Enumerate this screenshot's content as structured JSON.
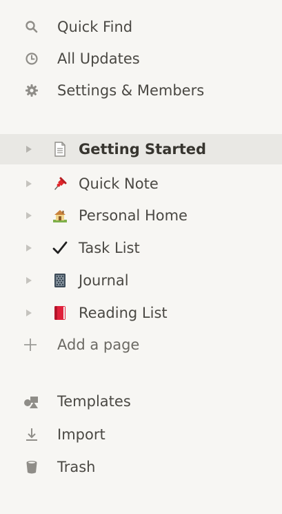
{
  "top_items": [
    {
      "label": "Quick Find",
      "icon": "search-icon"
    },
    {
      "label": "All Updates",
      "icon": "clock-icon"
    },
    {
      "label": "Settings & Members",
      "icon": "gear-icon"
    }
  ],
  "pages": [
    {
      "label": "Getting Started",
      "icon": "document-icon",
      "active": true
    },
    {
      "label": "Quick Note",
      "icon": "pushpin-icon",
      "active": false
    },
    {
      "label": "Personal Home",
      "icon": "house-icon",
      "active": false
    },
    {
      "label": "Task List",
      "icon": "checkmark-icon",
      "active": false
    },
    {
      "label": "Journal",
      "icon": "notebook-icon",
      "active": false
    },
    {
      "label": "Reading List",
      "icon": "red-book-icon",
      "active": false
    }
  ],
  "add_page": {
    "label": "Add a page",
    "icon": "plus-icon"
  },
  "bottom_items": [
    {
      "label": "Templates",
      "icon": "templates-icon"
    },
    {
      "label": "Import",
      "icon": "download-icon"
    },
    {
      "label": "Trash",
      "icon": "trash-icon"
    }
  ],
  "colors": {
    "sidebar_bg": "#f7f6f3",
    "active_row_bg": "#e9e8e4",
    "text": "#4a4843",
    "icon_gray": "#9b9a97"
  }
}
